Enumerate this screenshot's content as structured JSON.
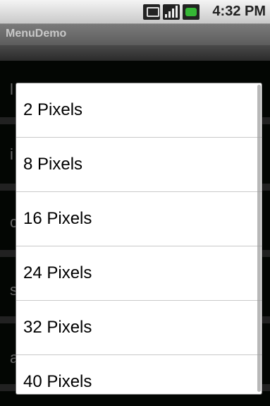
{
  "status_bar": {
    "time": "4:32 PM",
    "icons": [
      "data-sync-icon",
      "signal-icon",
      "battery-icon"
    ]
  },
  "app": {
    "title": "MenuDemo"
  },
  "background_list": {
    "visible_letters": [
      "l",
      "i",
      "c",
      "s",
      "a"
    ]
  },
  "menu": {
    "items": [
      "2 Pixels",
      "8 Pixels",
      "16 Pixels",
      "24 Pixels",
      "32 Pixels",
      "40 Pixels"
    ]
  }
}
